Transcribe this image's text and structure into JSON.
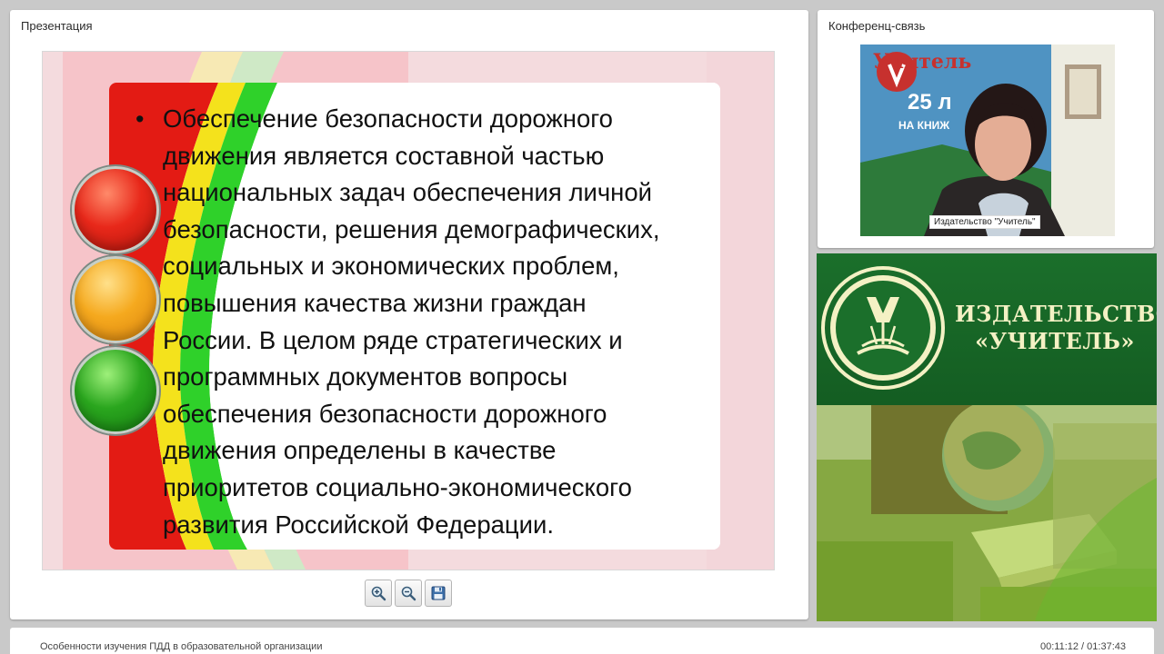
{
  "presentation": {
    "title": "Презентация",
    "slide": {
      "lines": [
        "Обеспечение безопасности дорожного",
        "движения является составной частью",
        "национальных задач обеспечения личной",
        "безопасности, решения демографических,",
        "социальных и экономических проблем,",
        "повышения качества жизни граждан",
        "России. В целом ряде стратегических и",
        "программных документов вопросы",
        "обеспечения безопасности дорожного",
        "движения определены в качестве",
        "приоритетов социально-экономического",
        "развития Российской Федерации."
      ],
      "bullet": "•",
      "traffic_light_colors": [
        "#e8281a",
        "#f5a91e",
        "#2aa61e"
      ]
    },
    "toolbar": {
      "zoom_in_icon": "zoom-in-icon",
      "zoom_out_icon": "zoom-out-icon",
      "save_icon": "save-icon"
    }
  },
  "conference": {
    "title": "Конференц-связь",
    "participant_label": "Издательство \"Учитель\"",
    "poster_text": "Учитель",
    "poster_number": "25 л",
    "poster_sub": "НА КНИЖ"
  },
  "brand": {
    "name_line1": "ИЗДАТЕЛЬСТВО",
    "name_line2": "«УЧИТЕЛЬ»",
    "accent": "#1b6f2b",
    "text_color": "#f4f1c4"
  },
  "footer": {
    "lecture_title": "Особенности изучения ПДД в образовательной организации",
    "time": "00:11:12 / 01:37:43"
  }
}
